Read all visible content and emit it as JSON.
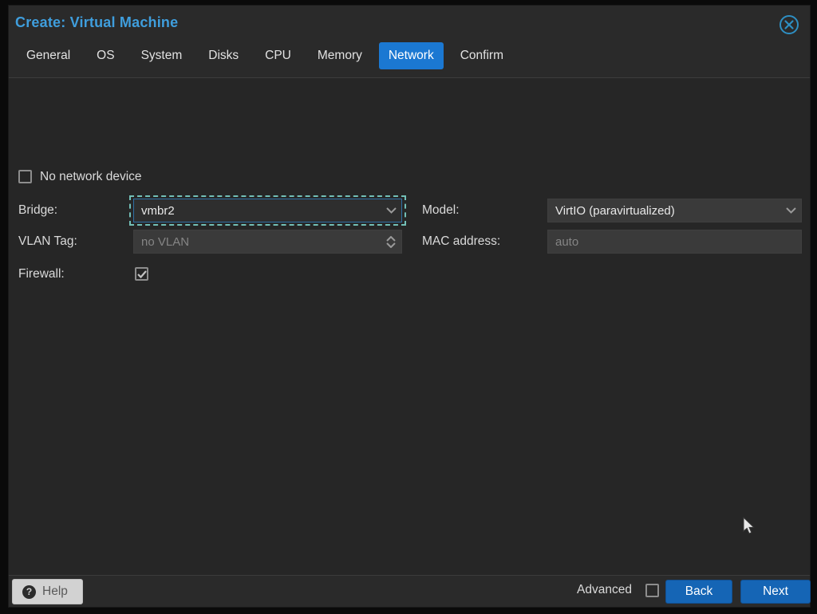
{
  "dialog": {
    "title": "Create: Virtual Machine"
  },
  "tabs": [
    {
      "label": "General",
      "active": false
    },
    {
      "label": "OS",
      "active": false
    },
    {
      "label": "System",
      "active": false
    },
    {
      "label": "Disks",
      "active": false
    },
    {
      "label": "CPU",
      "active": false
    },
    {
      "label": "Memory",
      "active": false
    },
    {
      "label": "Network",
      "active": true
    },
    {
      "label": "Confirm",
      "active": false
    }
  ],
  "form": {
    "no_network_device": {
      "label": "No network device",
      "checked": false
    },
    "bridge": {
      "label": "Bridge:",
      "value": "vmbr2",
      "focused": true
    },
    "vlan": {
      "label": "VLAN Tag:",
      "value": "",
      "placeholder": "no VLAN"
    },
    "firewall": {
      "label": "Firewall:",
      "checked": true
    },
    "model": {
      "label": "Model:",
      "value": "VirtIO (paravirtualized)"
    },
    "mac": {
      "label": "MAC address:",
      "value": "",
      "placeholder": "auto"
    }
  },
  "footer": {
    "help_label": "Help",
    "help_icon_glyph": "?",
    "advanced_label": "Advanced",
    "advanced_checked": false,
    "back_label": "Back",
    "next_label": "Next"
  },
  "colors": {
    "title_blue": "#3f9edd",
    "active_tab_blue": "#1b78d2",
    "button_blue": "#1565b5",
    "focus_dash_teal": "#72bfb7",
    "close_icon_blue": "#2e8fc3",
    "dialog_bg": "#272727",
    "field_bg": "#3a3a3a",
    "placeholder_gray": "#858585"
  }
}
